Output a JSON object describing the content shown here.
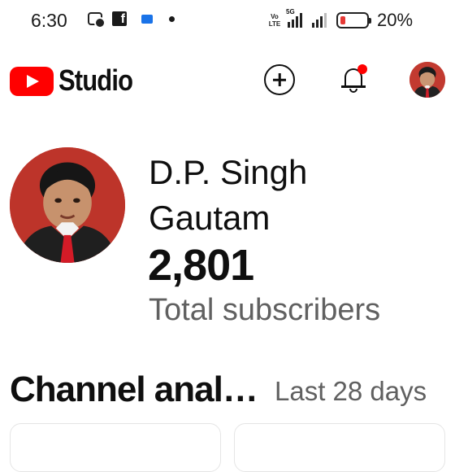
{
  "status_bar": {
    "time": "6:30",
    "volte_label": "Vo\nLTE",
    "network_label": "5G",
    "battery_percent": "20%",
    "battery_level": 0.2,
    "battery_color": "#e53935"
  },
  "app_bar": {
    "brand_name": "Studio",
    "brand_color": "#ff0000",
    "notification_badge_color": "#ff0000"
  },
  "channel": {
    "name": "D.P. Singh Gautam",
    "subscriber_count": "2,801",
    "subscriber_label": "Total subscribers"
  },
  "analytics": {
    "title": "Channel analytics",
    "period": "Last 28 days"
  }
}
